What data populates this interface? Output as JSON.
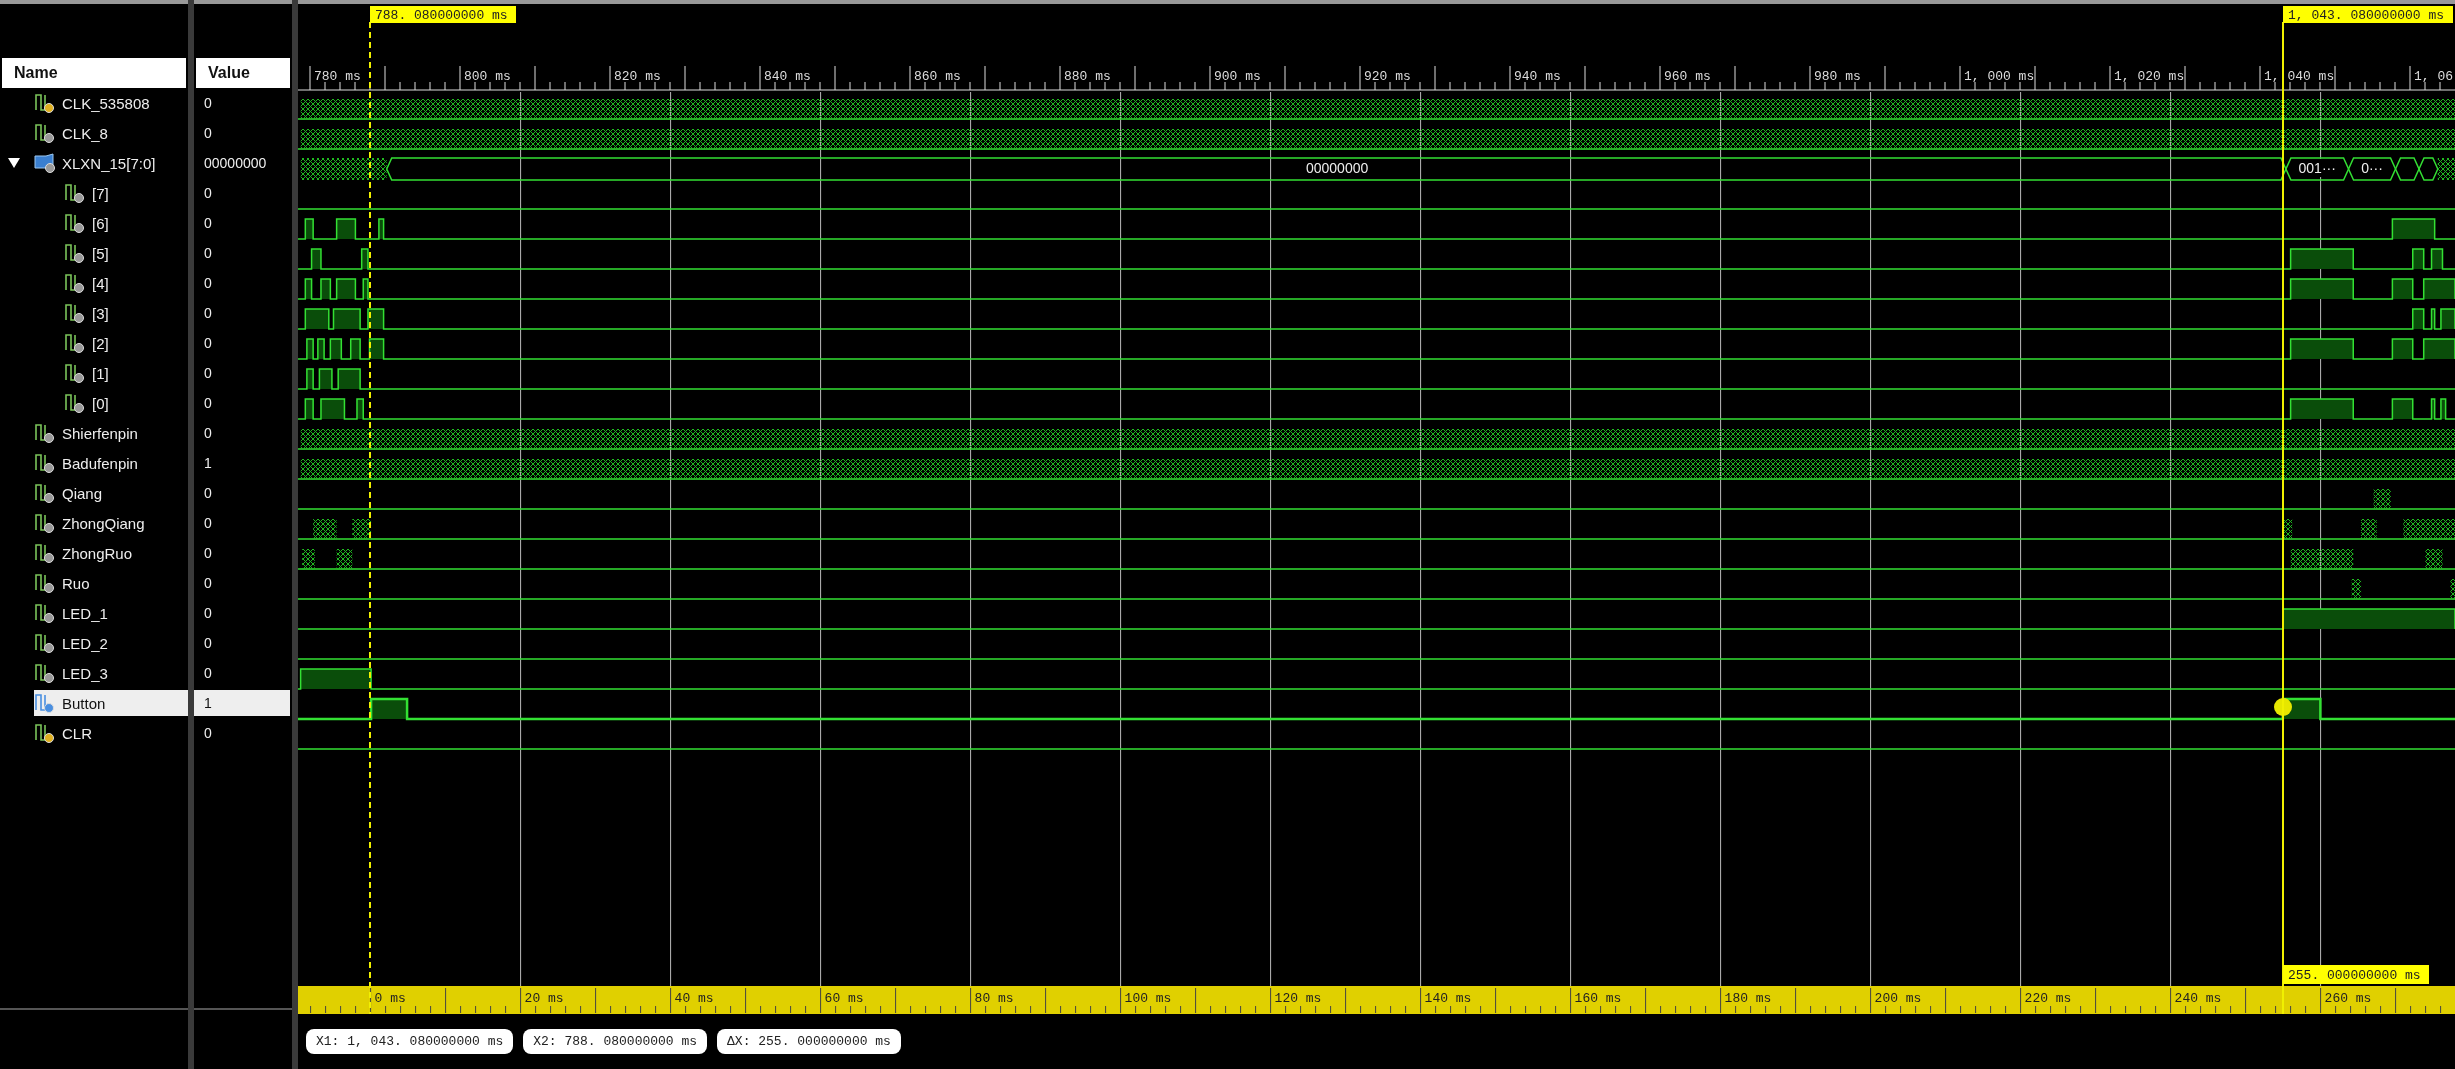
{
  "columns": {
    "name": "Name",
    "value": "Value"
  },
  "signals": [
    {
      "name": "CLK_535808",
      "value": "0",
      "kind": "input",
      "selected": false
    },
    {
      "name": "CLK_8",
      "value": "0",
      "kind": "signal",
      "selected": false
    },
    {
      "name": "XLXN_15[7:0]",
      "value": "00000000",
      "kind": "bus",
      "selected": false,
      "expanded": true,
      "bus_values": [
        "00000000",
        "001···",
        "0···"
      ],
      "children": [
        {
          "name": "[7]",
          "value": "0",
          "kind": "signal",
          "selected": false
        },
        {
          "name": "[6]",
          "value": "0",
          "kind": "signal",
          "selected": false
        },
        {
          "name": "[5]",
          "value": "0",
          "kind": "signal",
          "selected": false
        },
        {
          "name": "[4]",
          "value": "0",
          "kind": "signal",
          "selected": false
        },
        {
          "name": "[3]",
          "value": "0",
          "kind": "signal",
          "selected": false
        },
        {
          "name": "[2]",
          "value": "0",
          "kind": "signal",
          "selected": false
        },
        {
          "name": "[1]",
          "value": "0",
          "kind": "signal",
          "selected": false
        },
        {
          "name": "[0]",
          "value": "0",
          "kind": "signal",
          "selected": false
        }
      ]
    },
    {
      "name": "Shierfenpin",
      "value": "0",
      "kind": "signal",
      "selected": false
    },
    {
      "name": "Badufenpin",
      "value": "1",
      "kind": "signal",
      "selected": false
    },
    {
      "name": "Qiang",
      "value": "0",
      "kind": "signal",
      "selected": false
    },
    {
      "name": "ZhongQiang",
      "value": "0",
      "kind": "signal",
      "selected": false
    },
    {
      "name": "ZhongRuo",
      "value": "0",
      "kind": "signal",
      "selected": false
    },
    {
      "name": "Ruo",
      "value": "0",
      "kind": "signal",
      "selected": false
    },
    {
      "name": "LED_1",
      "value": "0",
      "kind": "signal",
      "selected": false
    },
    {
      "name": "LED_2",
      "value": "0",
      "kind": "signal",
      "selected": false
    },
    {
      "name": "LED_3",
      "value": "0",
      "kind": "signal",
      "selected": false
    },
    {
      "name": "Button",
      "value": "1",
      "kind": "signal",
      "selected": true
    },
    {
      "name": "CLR",
      "value": "0",
      "kind": "input",
      "selected": false
    }
  ],
  "top_ruler": {
    "labels": [
      "780 ms",
      "800 ms",
      "820 ms",
      "840 ms",
      "860 ms",
      "880 ms",
      "900 ms",
      "920 ms",
      "940 ms",
      "960 ms",
      "980 ms",
      "1, 000 ms",
      "1, 020 ms",
      "1, 040 ms",
      "1, 06"
    ]
  },
  "bottom_ruler": {
    "labels": [
      "0 ms",
      "20 ms",
      "40 ms",
      "60 ms",
      "80 ms",
      "100 ms",
      "120 ms",
      "140 ms",
      "160 ms",
      "180 ms",
      "200 ms",
      "220 ms",
      "240 ms",
      "260 ms"
    ]
  },
  "cursors": [
    {
      "label": "788. 080000000 ms",
      "kind": "dashed"
    },
    {
      "label": "1, 043. 080000000 ms",
      "kind": "solid"
    }
  ],
  "delta_label": "255. 000000000 ms",
  "readouts": [
    "X1: 1, 043. 080000000 ms",
    "X2: 788. 080000000 ms",
    "ΔX: 255. 000000000 ms"
  ]
}
